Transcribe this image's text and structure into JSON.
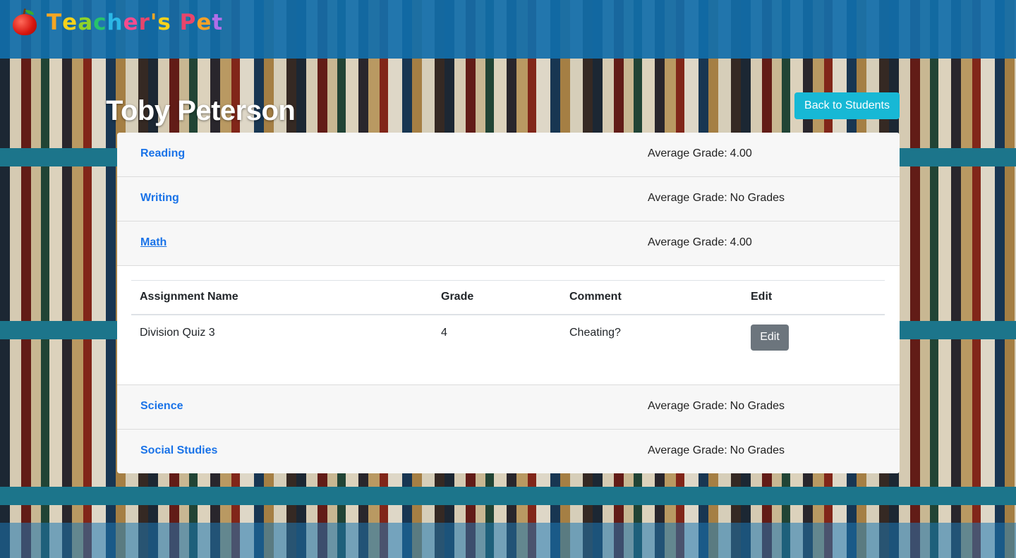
{
  "header": {
    "brand_letters": [
      {
        "ch": "T",
        "color": "#f5a623"
      },
      {
        "ch": "e",
        "color": "#f7d21b"
      },
      {
        "ch": "a",
        "color": "#8ed22b"
      },
      {
        "ch": "c",
        "color": "#27c46b"
      },
      {
        "ch": "h",
        "color": "#2bb7e6"
      },
      {
        "ch": "e",
        "color": "#f54c8e"
      },
      {
        "ch": "r",
        "color": "#e8456b"
      },
      {
        "ch": "'",
        "color": "#f5a623"
      },
      {
        "ch": "s",
        "color": "#f7d21b"
      },
      {
        "ch": " ",
        "color": "#ffffff"
      },
      {
        "ch": "P",
        "color": "#e8456b"
      },
      {
        "ch": "e",
        "color": "#f7a127"
      },
      {
        "ch": "t",
        "color": "#b06ee8"
      }
    ],
    "logo_icon": "apple-icon"
  },
  "page": {
    "student_name": "Toby Peterson",
    "back_button_label": "Back to Students"
  },
  "subjects_top": [
    {
      "name": "Reading",
      "avg_label": "Average Grade:",
      "avg_value": "4.00"
    },
    {
      "name": "Writing",
      "avg_label": "Average Grade:",
      "avg_value": "No Grades"
    },
    {
      "name": "Math",
      "avg_label": "Average Grade:",
      "avg_value": "4.00"
    }
  ],
  "assignments": {
    "columns": [
      "Assignment Name",
      "Grade",
      "Comment",
      "Edit"
    ],
    "rows": [
      {
        "name": "Division Quiz 3",
        "grade": "4",
        "comment": "Cheating?",
        "edit_label": "Edit"
      }
    ]
  },
  "subjects_bottom": [
    {
      "name": "Science",
      "avg_label": "Average Grade:",
      "avg_value": "No Grades"
    },
    {
      "name": "Social Studies",
      "avg_label": "Average Grade:",
      "avg_value": "No Grades"
    }
  ],
  "colors": {
    "navbar": "#116eaa",
    "link": "#1a73e8",
    "back_button": "#17b8d5",
    "edit_button": "#6c757d"
  }
}
